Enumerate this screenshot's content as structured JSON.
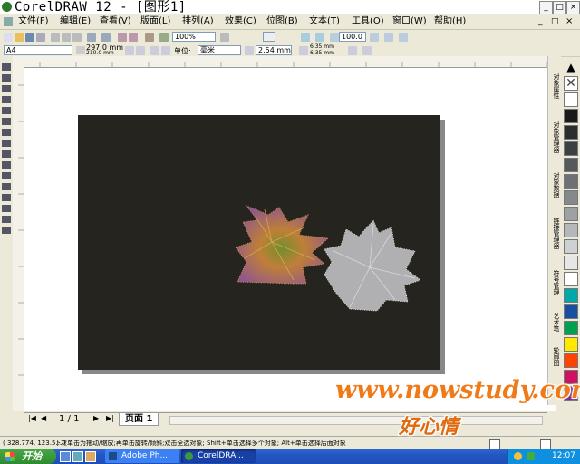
{
  "window": {
    "title": "CorelDRAW 12 - [图形1]",
    "minimize": "_",
    "restore": "□",
    "close": "×"
  },
  "menus": [
    "文件(F)",
    "编辑(E)",
    "查看(V)",
    "版面(L)",
    "排列(A)",
    "效果(C)",
    "位图(B)",
    "文本(T)",
    "工具(O)",
    "窗口(W)",
    "帮助(H)"
  ],
  "toolbar_standard": {
    "zoom_value": "100%",
    "snap_value": "100.0"
  },
  "property_bar": {
    "paper_size": "A4",
    "width": "297.0 mm",
    "height": "210.0 mm",
    "units_label": "单位:",
    "units_value": "毫米",
    "nudge": "2.54 mm",
    "dup_x": "6.35 mm",
    "dup_y": "6.35 mm"
  },
  "docker_tabs": [
    "对象属性",
    "对象管理器",
    "对象数据",
    "链接管理器",
    "符号管理",
    "艺术笔",
    "轮廓图"
  ],
  "palette_colors": [
    "#ffffff",
    "#1a1a1a",
    "#2b2d2e",
    "#3d4043",
    "#55595c",
    "#6d7175",
    "#86898c",
    "#9ea0a3",
    "#b5b7b9",
    "#cfd0d2",
    "#e6e6e6",
    "#ffffff",
    "#00a8a8",
    "#1a4fa0",
    "#00a050",
    "#ffe800",
    "#ff4400",
    "#d01060",
    "#7a2a8c"
  ],
  "page_nav": {
    "counter": "1 / 1",
    "tab_label": "页面 1"
  },
  "status": {
    "coords": "( 328.774, 123.5... )",
    "message": "下次单击为拖动/缩放;再单击旋转/倾斜;双击全选对象; Shift+单击选择多个对象; Alt+单击选择后面对象"
  },
  "taskbar": {
    "start_label": "开始",
    "tasks": [
      "Adobe Ph...",
      "CorelDRA..."
    ],
    "clock": "12:07"
  },
  "watermark": {
    "url": "www.nowstudy.com",
    "signature": "好心情"
  },
  "icons": {
    "app": "coreldraw-logo-icon",
    "close": "close-icon"
  }
}
